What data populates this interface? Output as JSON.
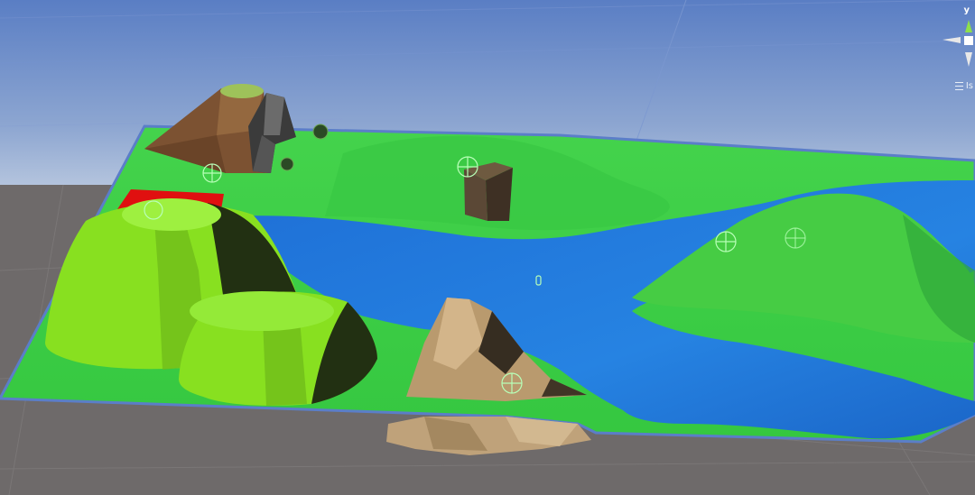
{
  "app": {
    "window": "Scene View"
  },
  "gizmo": {
    "axis_label": "y",
    "projection_label": "Is",
    "colors": {
      "y_axis": "#8ee04b",
      "x_axis": "#ffffff",
      "neutral": "#e8e8e8"
    }
  },
  "scene": {
    "colors": {
      "sky_top": "#5b7fc4",
      "sky_bottom": "#b7c6df",
      "ground_plane": "#6e6a6a",
      "terrain_green": "#3fd24a",
      "water": "#1f78d9",
      "hill_green": "#86e62a",
      "rock_brown": "#7a5232",
      "sand_rock": "#b99a6e",
      "selection_red": "#e01010",
      "outline": "#5b7ec8"
    },
    "objects": [
      {
        "name": "terrain"
      },
      {
        "name": "lake"
      },
      {
        "name": "mountain-brown"
      },
      {
        "name": "rock-dark"
      },
      {
        "name": "hill-big"
      },
      {
        "name": "hill-small"
      },
      {
        "name": "sand-rocks"
      },
      {
        "name": "crate-cube"
      },
      {
        "name": "right-hill"
      }
    ]
  }
}
